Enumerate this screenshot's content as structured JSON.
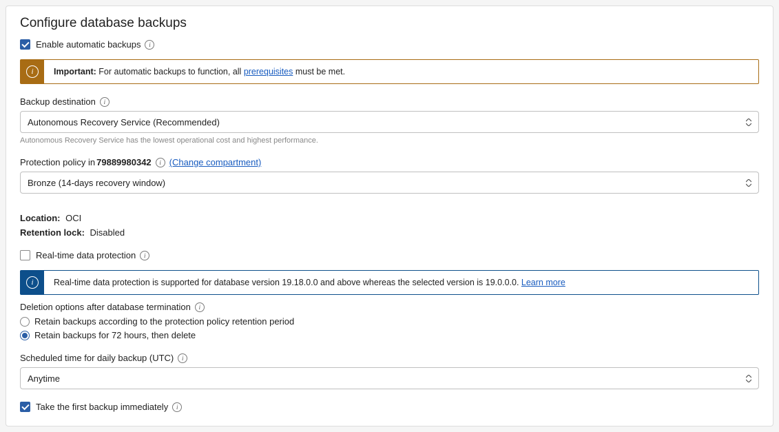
{
  "title": "Configure database backups",
  "enable_automatic": {
    "label": "Enable automatic backups",
    "checked": true
  },
  "important_alert": {
    "bold": "Important:",
    "text": " For automatic backups to function, all ",
    "link": "prerequisites",
    "text_after": " must be met."
  },
  "backup_destination": {
    "label": "Backup destination",
    "value": "Autonomous Recovery Service (Recommended)",
    "help": "Autonomous Recovery Service has the lowest operational cost and highest performance."
  },
  "protection_policy": {
    "label_prefix": "Protection policy in ",
    "compartment": "79889980342",
    "change_link": "(Change compartment)",
    "value": "Bronze (14-days recovery window)"
  },
  "location": {
    "label": "Location:",
    "value": "OCI"
  },
  "retention_lock": {
    "label": "Retention lock:",
    "value": "Disabled"
  },
  "realtime": {
    "label": "Real-time data protection",
    "checked": false
  },
  "realtime_alert": {
    "text": "Real-time data protection is supported for database version 19.18.0.0 and above whereas the selected version is 19.0.0.0. ",
    "link": "Learn more"
  },
  "deletion_options": {
    "label": "Deletion options after database termination",
    "options": [
      {
        "label": "Retain backups according to the protection policy retention period",
        "checked": false
      },
      {
        "label": "Retain backups for 72 hours, then delete",
        "checked": true
      }
    ]
  },
  "scheduled_time": {
    "label": "Scheduled time for daily backup (UTC)",
    "value": "Anytime"
  },
  "first_backup": {
    "label": "Take the first backup immediately",
    "checked": true
  }
}
